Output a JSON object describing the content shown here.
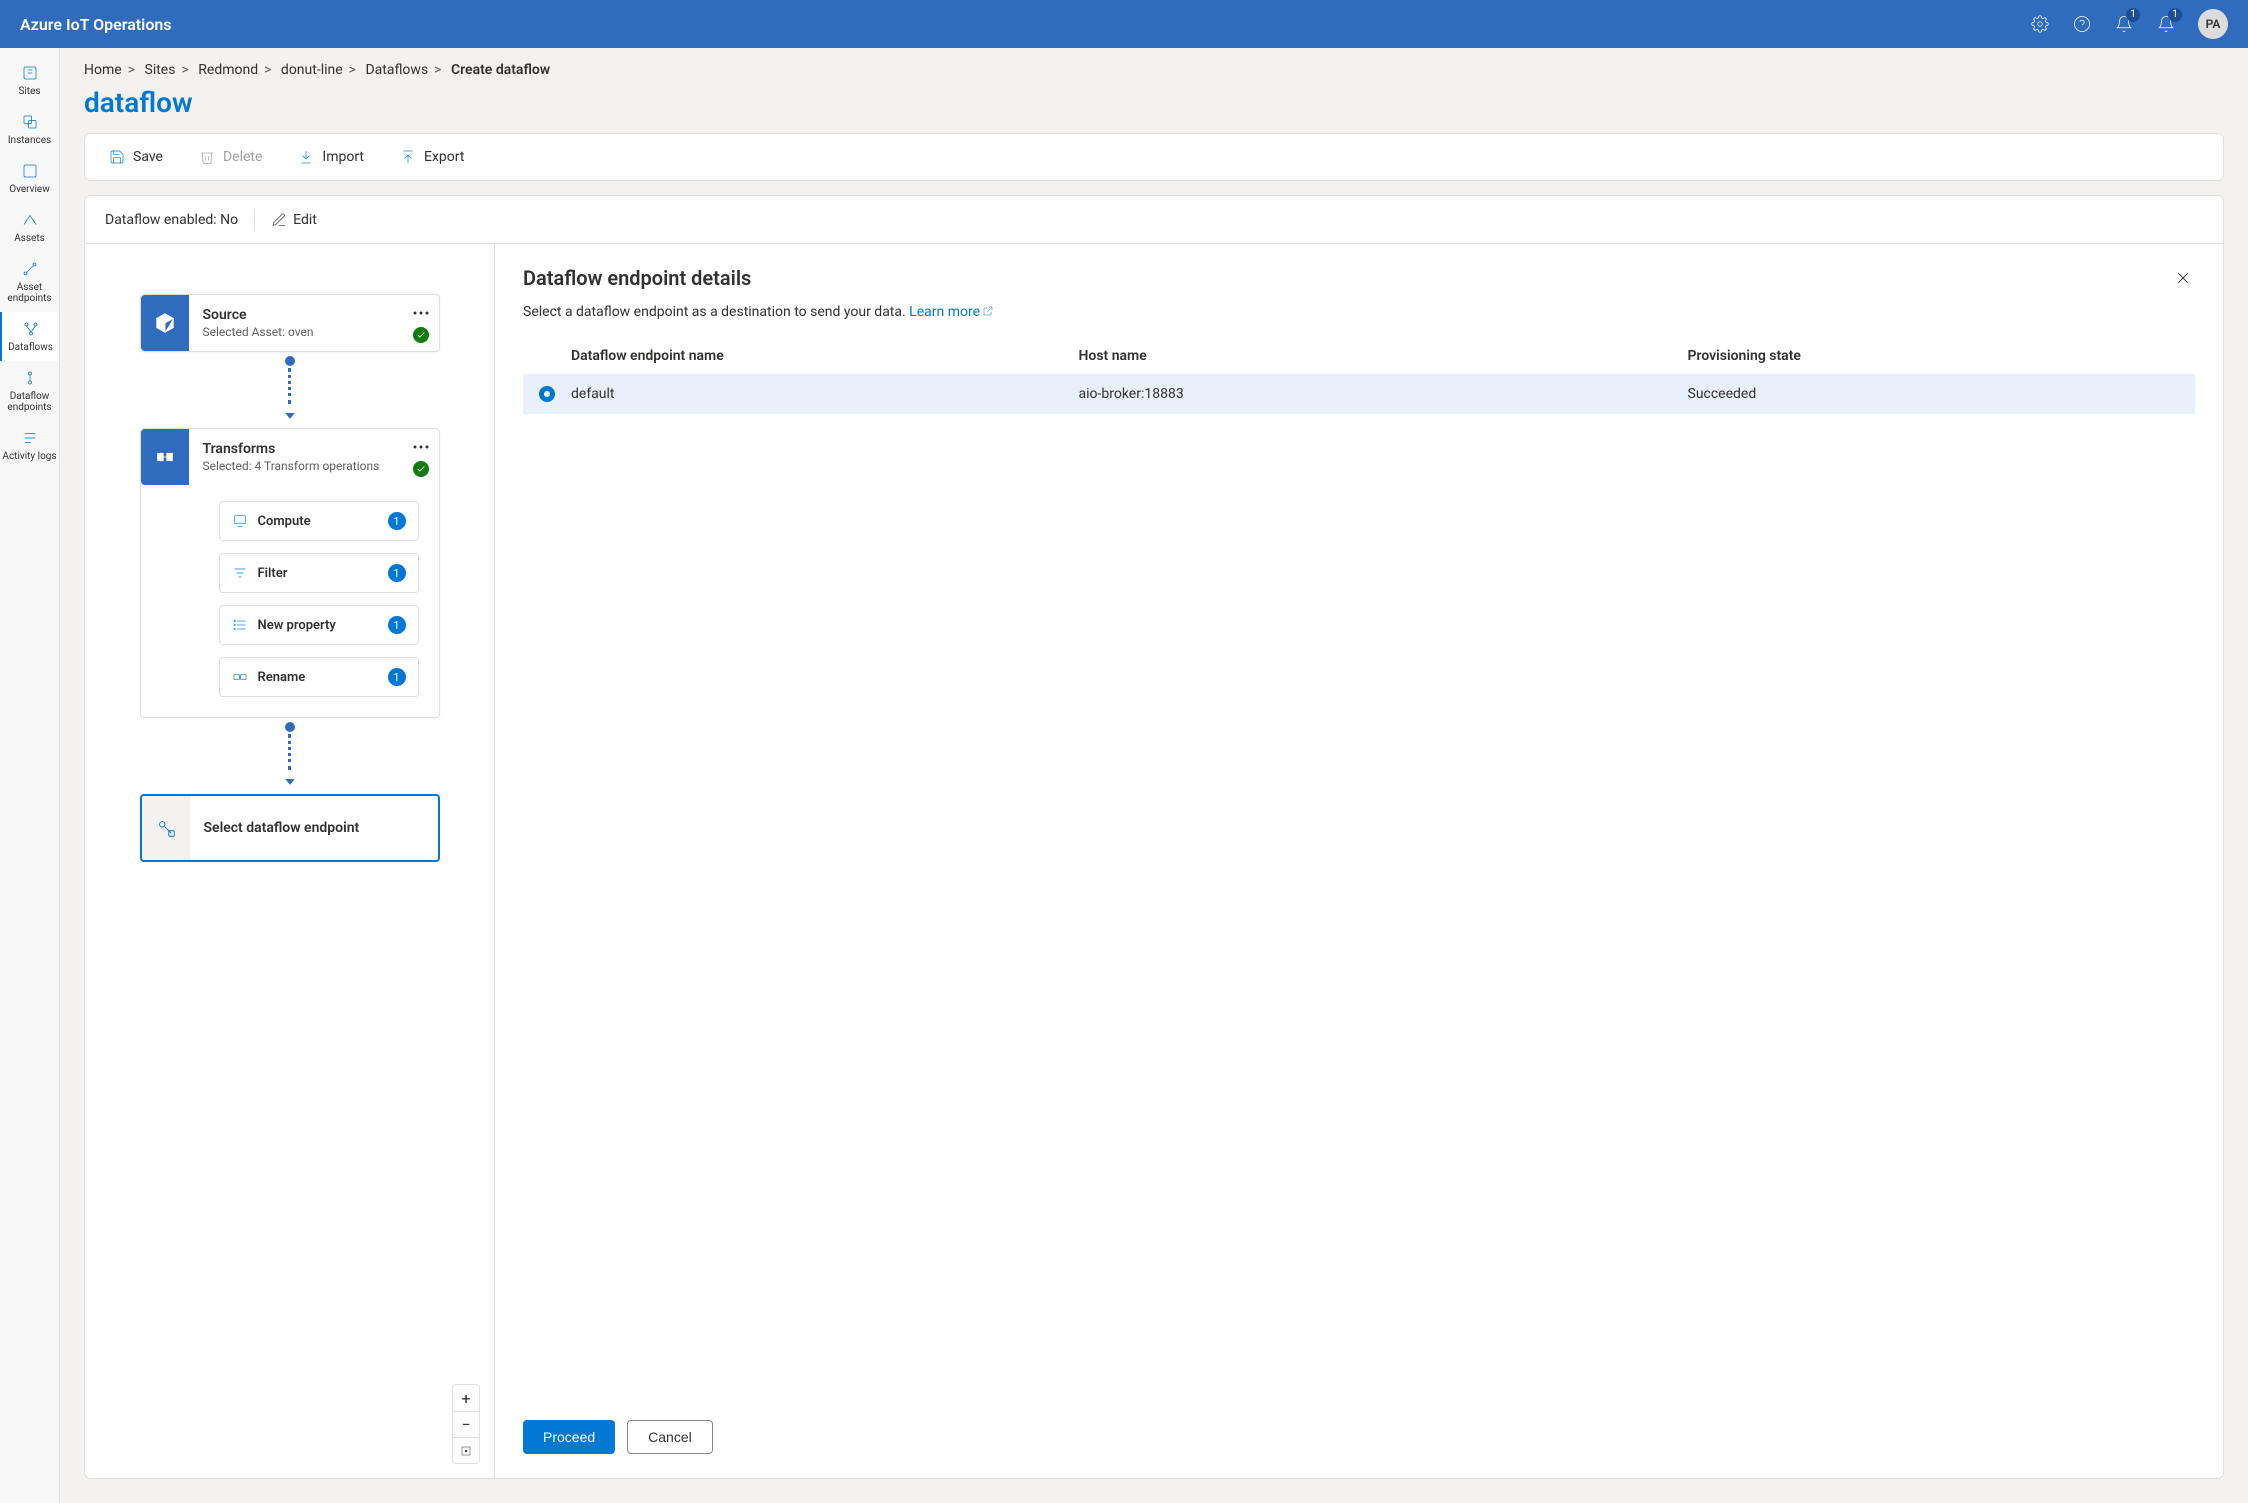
{
  "topbar": {
    "title": "Azure IoT Operations",
    "badge1": "1",
    "badge2": "1",
    "avatar": "PA"
  },
  "leftnav": {
    "items": [
      {
        "label": "Sites"
      },
      {
        "label": "Instances"
      },
      {
        "label": "Overview"
      },
      {
        "label": "Assets"
      },
      {
        "label": "Asset endpoints"
      },
      {
        "label": "Dataflows"
      },
      {
        "label": "Dataflow endpoints"
      },
      {
        "label": "Activity logs"
      }
    ]
  },
  "breadcrumbs": {
    "items": [
      "Home",
      "Sites",
      "Redmond",
      "donut-line",
      "Dataflows"
    ],
    "current": "Create dataflow"
  },
  "page_title": "dataflow",
  "toolbar": {
    "save": "Save",
    "delete": "Delete",
    "import": "Import",
    "export": "Export"
  },
  "status": {
    "enabled_label": "Dataflow enabled: No",
    "edit": "Edit"
  },
  "flow": {
    "source": {
      "title": "Source",
      "sub": "Selected Asset: oven"
    },
    "transforms": {
      "title": "Transforms",
      "sub": "Selected: 4 Transform operations",
      "chips": [
        {
          "label": "Compute",
          "count": "1"
        },
        {
          "label": "Filter",
          "count": "1"
        },
        {
          "label": "New property",
          "count": "1"
        },
        {
          "label": "Rename",
          "count": "1"
        }
      ]
    },
    "dest": {
      "label": "Select dataflow endpoint"
    }
  },
  "panel": {
    "title": "Dataflow endpoint details",
    "desc": "Select a dataflow endpoint as a destination to send your data. ",
    "learn_more": "Learn more",
    "table": {
      "headers": {
        "name": "Dataflow endpoint name",
        "host": "Host name",
        "state": "Provisioning state"
      },
      "rows": [
        {
          "name": "default",
          "host": "aio-broker:18883",
          "state": "Succeeded"
        }
      ]
    },
    "proceed": "Proceed",
    "cancel": "Cancel"
  }
}
